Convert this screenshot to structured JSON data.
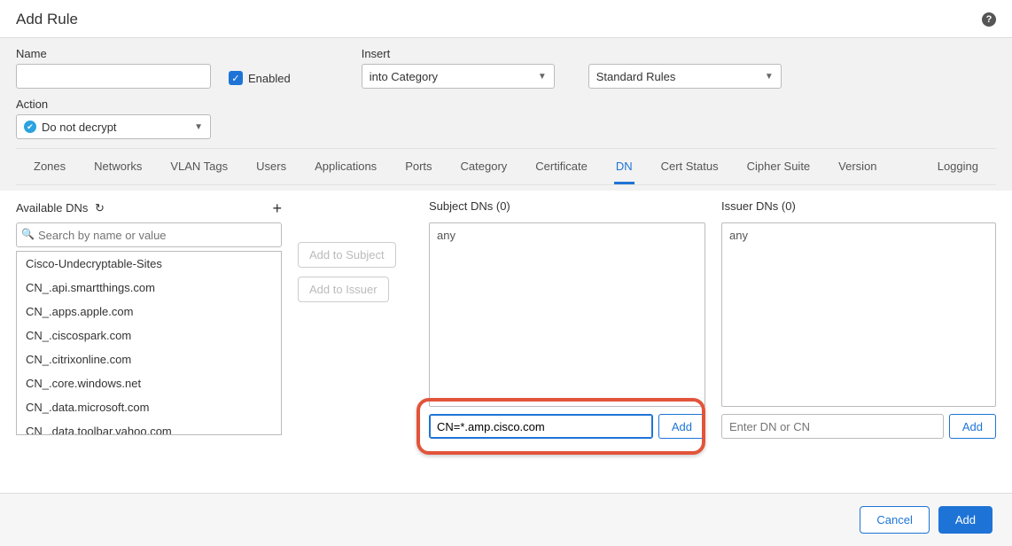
{
  "header": {
    "title": "Add Rule"
  },
  "form": {
    "name_label": "Name",
    "name_value": "",
    "enabled_label": "Enabled",
    "enabled_checked": true,
    "insert_label": "Insert",
    "insert_value": "into Category",
    "rules_value": "Standard Rules",
    "action_label": "Action",
    "action_value": "Do not decrypt"
  },
  "tabs": {
    "items": [
      "Zones",
      "Networks",
      "VLAN Tags",
      "Users",
      "Applications",
      "Ports",
      "Category",
      "Certificate",
      "DN",
      "Cert Status",
      "Cipher Suite",
      "Version"
    ],
    "right": "Logging",
    "active_index": 8
  },
  "available": {
    "label": "Available DNs",
    "search_placeholder": "Search by name or value",
    "items": [
      "Cisco-Undecryptable-Sites",
      "CN_.api.smartthings.com",
      "CN_.apps.apple.com",
      "CN_.ciscospark.com",
      "CN_.citrixonline.com",
      "CN_.core.windows.net",
      "CN_.data.microsoft.com",
      "CN_.data.toolbar.yahoo.com"
    ]
  },
  "actions": {
    "add_subject": "Add to Subject",
    "add_issuer": "Add to Issuer"
  },
  "subject": {
    "label": "Subject DNs (0)",
    "body": "any",
    "input_value": "CN=*.amp.cisco.com",
    "add_label": "Add"
  },
  "issuer": {
    "label": "Issuer DNs (0)",
    "body": "any",
    "input_placeholder": "Enter DN or CN",
    "add_label": "Add"
  },
  "footer": {
    "cancel": "Cancel",
    "add": "Add"
  }
}
